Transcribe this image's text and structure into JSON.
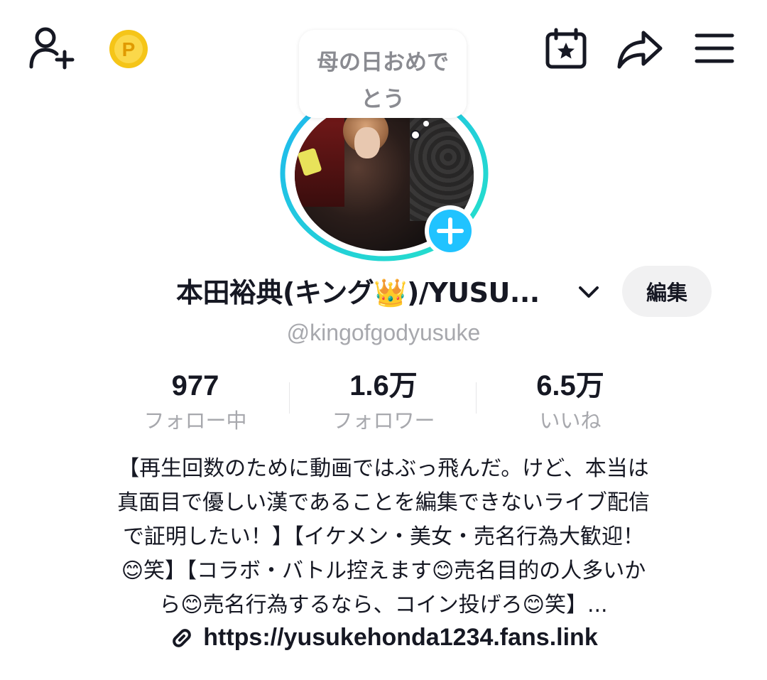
{
  "header": {
    "icons": {
      "add_friend": "add-friend-icon",
      "coin": "coin-icon",
      "calendar": "calendar-star-icon",
      "share": "share-icon",
      "menu": "menu-icon"
    },
    "coin_letter": "P"
  },
  "status_bubble": {
    "line1": "母の日おめで",
    "line2": "とう"
  },
  "profile": {
    "display_name": "本田裕典(キング👑)/YUSU...",
    "edit_label": "編集",
    "username": "@kingofgodyusuke",
    "accent_ring_colors": [
      "#1fb6f0",
      "#25e2c8"
    ],
    "badge_color": "#20c3ff"
  },
  "stats": {
    "following": {
      "value": "977",
      "label": "フォロー中"
    },
    "followers": {
      "value": "1.6万",
      "label": "フォロワー"
    },
    "likes": {
      "value": "6.5万",
      "label": "いいね"
    }
  },
  "bio": {
    "lines": [
      "【再生回数のために動画ではぶっ飛んだ。けど、本当は",
      "真面目で優しい漢であることを編集できないライブ配信",
      "で証明したい！】【イケメン・美女・売名行為大歓迎！",
      "😊笑】【コラボ・バトル控えます😊売名目的の人多いか",
      "ら😊売名行為するなら、コイン投げろ😊笑】..."
    ]
  },
  "link": {
    "url": "https://yusukehonda1234.fans.link",
    "icon": "link-icon"
  }
}
